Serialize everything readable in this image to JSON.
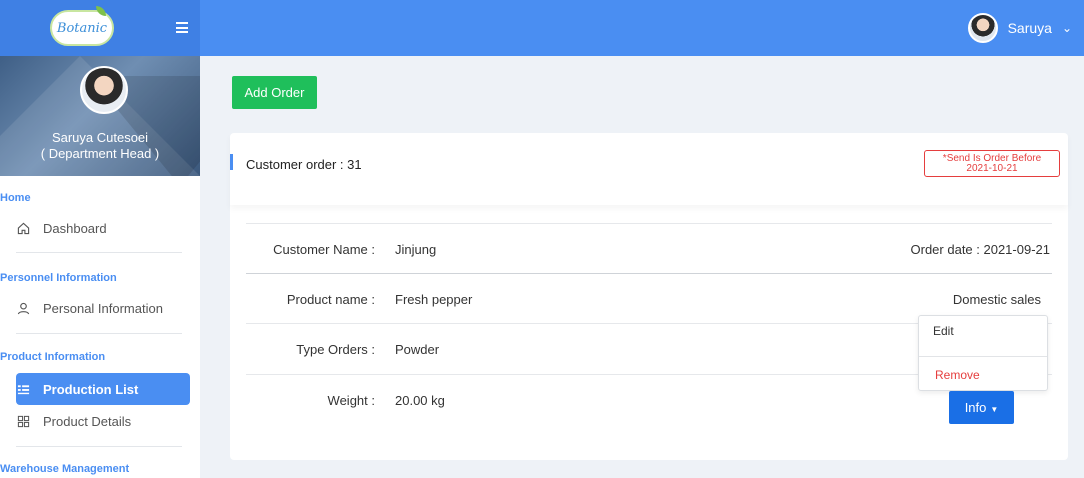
{
  "header": {
    "logo_text": "Botanic",
    "user_name": "Saruya",
    "user_caret": "⌄"
  },
  "sidebar": {
    "profile": {
      "name": "Saruya Cutesoei",
      "role": "( Department Head )"
    },
    "sections": [
      {
        "title": "Home",
        "items": [
          {
            "label": "Dashboard",
            "icon": "home-icon"
          }
        ]
      },
      {
        "title": "Personnel Information",
        "items": [
          {
            "label": "Personal Information",
            "icon": "user-icon"
          }
        ]
      },
      {
        "title": "Product Information",
        "items": [
          {
            "label": "Production List",
            "icon": "list-icon",
            "active": true
          },
          {
            "label": "Product Details",
            "icon": "grid-icon"
          }
        ]
      },
      {
        "title": "Warehouse Management",
        "items": []
      }
    ]
  },
  "main": {
    "add_order_label": "Add Order",
    "card": {
      "title": "Customer order : 31",
      "deadline_line1": "*Send Is Order Before",
      "deadline_line2": "2021-10-21",
      "rows": [
        {
          "label": "Customer Name :",
          "value": "Jinjung"
        },
        {
          "label": "Product name :",
          "value": "Fresh pepper"
        },
        {
          "label": "Type Orders :",
          "value": "Powder"
        },
        {
          "label": "Weight :",
          "value": "20.00 kg"
        }
      ],
      "order_date": "Order date : 2021-09-21",
      "sales_type": "Domestic sales",
      "dropdown": {
        "edit_label": "Edit",
        "remove_label": "Remove"
      },
      "info_button_label": "Info"
    }
  },
  "colors": {
    "primary": "#4a8ef2",
    "success": "#1fbf5b",
    "danger": "#e53e3e",
    "info_button": "#1a6fe6"
  }
}
